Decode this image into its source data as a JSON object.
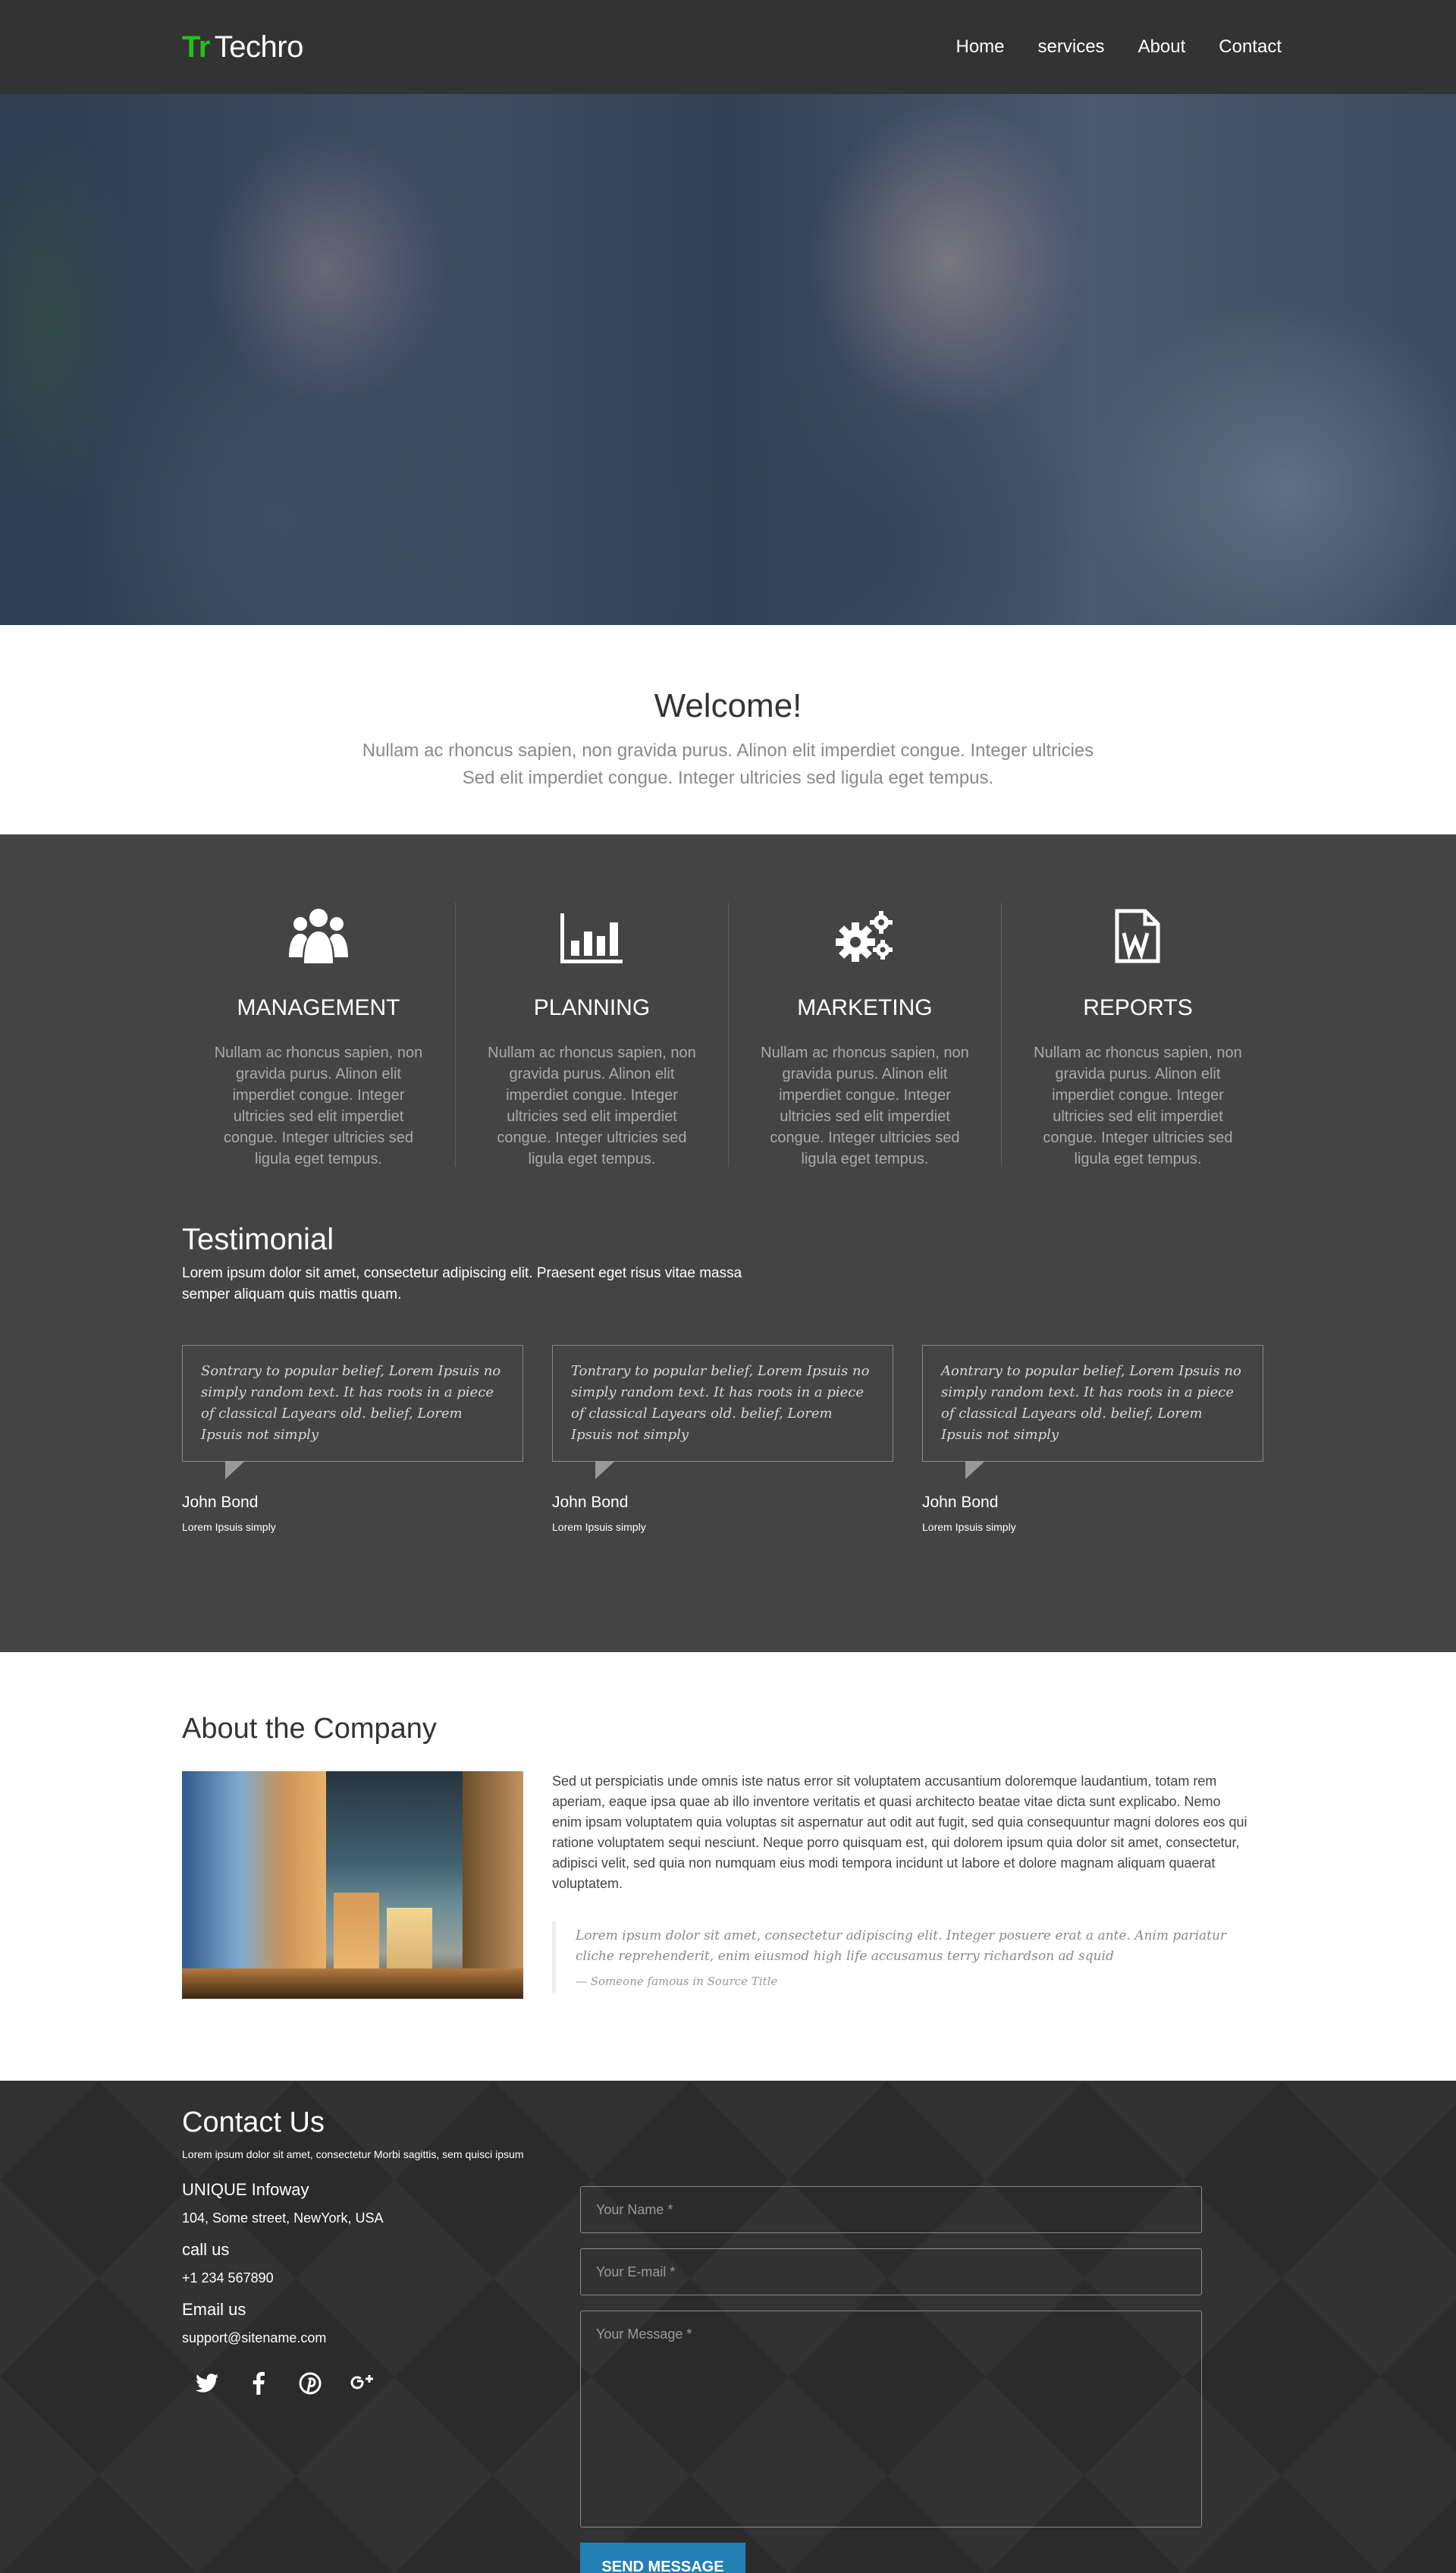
{
  "header": {
    "logo_mark": "Tr",
    "logo_text": "Techro",
    "nav": [
      "Home",
      "services",
      "About",
      "Contact"
    ]
  },
  "welcome": {
    "title": "Welcome!",
    "line1": "Nullam ac rhoncus sapien, non gravida purus. Alinon elit imperdiet congue. Integer ultricies",
    "line2": "Sed elit imperdiet congue. Integer ultricies sed ligula eget tempus."
  },
  "services": [
    {
      "icon": "users-icon",
      "title": "MANAGEMENT",
      "text": "Nullam ac rhoncus sapien, non gravida purus. Alinon elit imperdiet congue. Integer ultricies sed elit imperdiet congue. Integer ultricies sed ligula eget tempus."
    },
    {
      "icon": "bar-chart-icon",
      "title": "PLANNING",
      "text": "Nullam ac rhoncus sapien, non gravida purus. Alinon elit imperdiet congue. Integer ultricies sed elit imperdiet congue. Integer ultricies sed ligula eget tempus."
    },
    {
      "icon": "gears-icon",
      "title": "MARKETING",
      "text": "Nullam ac rhoncus sapien, non gravida purus. Alinon elit imperdiet congue. Integer ultricies sed elit imperdiet congue. Integer ultricies sed ligula eget tempus."
    },
    {
      "icon": "word-file-icon",
      "title": "REPORTS",
      "text": "Nullam ac rhoncus sapien, non gravida purus. Alinon elit imperdiet congue. Integer ultricies sed elit imperdiet congue. Integer ultricies sed ligula eget tempus."
    }
  ],
  "testimonial": {
    "title": "Testimonial",
    "intro": "Lorem ipsum dolor sit amet, consectetur adipiscing elit. Praesent eget risus vitae massa semper aliquam quis mattis quam.",
    "cards": [
      {
        "quote": "Sontrary to popular belief, Lorem Ipsuis no simply random text. It has roots in a piece of classical Layears old. belief, Lorem Ipsuis not simply",
        "name": "John Bond",
        "role": "Lorem Ipsuis simply"
      },
      {
        "quote": "Tontrary to popular belief, Lorem Ipsuis no simply random text. It has roots in a piece of classical Layears old. belief, Lorem Ipsuis not simply",
        "name": "John Bond",
        "role": "Lorem Ipsuis simply"
      },
      {
        "quote": "Aontrary to popular belief, Lorem Ipsuis no simply random text. It has roots in a piece of classical Layears old. belief, Lorem Ipsuis not simply",
        "name": "John Bond",
        "role": "Lorem Ipsuis simply"
      }
    ]
  },
  "about": {
    "title": "About the Company",
    "text": "Sed ut perspiciatis unde omnis iste natus error sit voluptatem accusantium doloremque laudantium, totam rem aperiam, eaque ipsa quae ab illo inventore veritatis et quasi architecto beatae vitae dicta sunt explicabo. Nemo enim ipsam voluptatem quia voluptas sit aspernatur aut odit aut fugit, sed quia consequuntur magni dolores eos qui ratione voluptatem sequi nesciunt. Neque porro quisquam est, qui dolorem ipsum quia dolor sit amet, consectetur, adipisci velit, sed quia non numquam eius modi tempora incidunt ut labore et dolore magnam aliquam quaerat voluptatem.",
    "quote": "Lorem ipsum dolor sit amet, consectetur adipiscing elit. Integer posuere erat a ante. Anim pariatur cliche reprehenderit, enim eiusmod high life accusamus terry richardson ad squid",
    "quote_source": "— Someone famous in Source Title"
  },
  "contact": {
    "title": "Contact Us",
    "subtitle": "Lorem ipsum dolor sit amet, consectetur Morbi sagittis, sem quisci ipsum",
    "company_label": "UNIQUE Infoway",
    "address": "104, Some street, NewYork, USA",
    "call_label": "call us",
    "phone": "+1 234 567890",
    "email_label": "Email us",
    "email": "support@sitename.com",
    "social": [
      "twitter-icon",
      "facebook-icon",
      "pinterest-icon",
      "google-plus-icon"
    ],
    "name_placeholder": "Your Name *",
    "email_placeholder": "Your E-mail *",
    "message_placeholder": "Your Message *",
    "send_label": "SEND MESSAGE",
    "button_color": "#2380b5"
  }
}
